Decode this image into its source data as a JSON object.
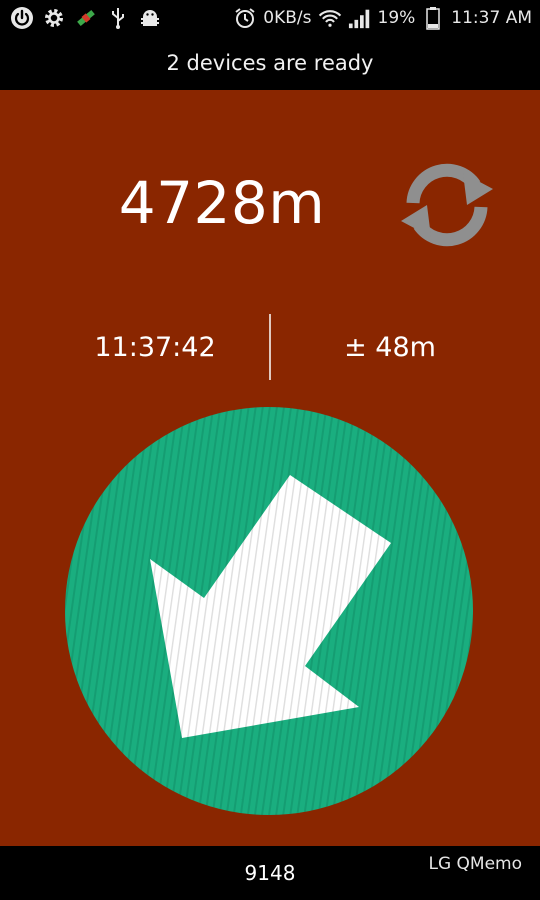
{
  "status_bar": {
    "network_speed": "0KB/s",
    "battery": "19%",
    "time": "11:37 AM"
  },
  "header": {
    "title": "2 devices are ready"
  },
  "main": {
    "distance": "4728m",
    "timestamp": "11:37:42",
    "accuracy": "± 48m"
  },
  "bottom": {
    "count": "9148",
    "overlay": "LG QMemo"
  },
  "colors": {
    "background": "#8a2600",
    "compass_fill": "#1aae7f",
    "arrow": "#ffffff",
    "refresh_icon": "#8f8f8f"
  }
}
